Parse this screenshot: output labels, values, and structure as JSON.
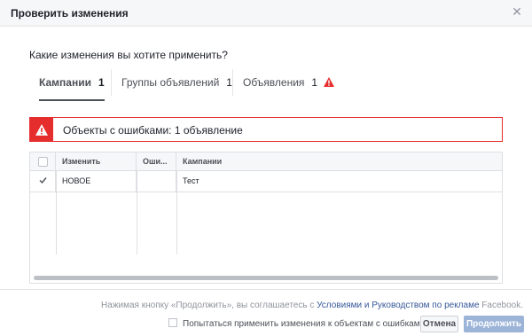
{
  "dialog": {
    "title": "Проверить изменения",
    "close_icon": "close-icon"
  },
  "question": "Какие изменения вы хотите применить?",
  "tabs": [
    {
      "label": "Кампании",
      "count": "1",
      "active": true
    },
    {
      "label": "Группы объявлений",
      "count": "1",
      "active": false
    },
    {
      "label": "Объявления",
      "count": "1",
      "active": false,
      "icon": "warning-icon"
    }
  ],
  "alert": {
    "icon": "warning-icon",
    "text": "Объекты с ошибками: 1 объявление",
    "color": "#e62d2d"
  },
  "table": {
    "columns": [
      "Изменить",
      "Оши...",
      "Кампании"
    ],
    "rows": [
      {
        "checked": true,
        "change": "НОВОЕ",
        "errors": "",
        "campaign": "Тест"
      }
    ]
  },
  "footer": {
    "agree_prefix": "Нажимая кнопку «Продолжить», вы соглашаетесь с ",
    "agree_link": "Условиями и Руководством по рекламе",
    "agree_suffix": " Facebook.",
    "try_label": "Попытаться применить изменения к объектам с ошибками",
    "cancel_label": "Отмена",
    "continue_label": "Продолжить"
  },
  "colors": {
    "accent": "#4267b2",
    "error": "#e62d2d",
    "continue_disabled": "#9cb4d8"
  }
}
